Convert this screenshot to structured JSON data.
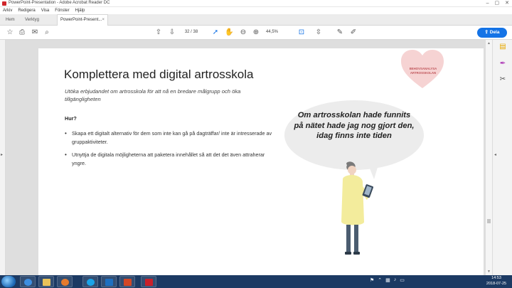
{
  "window": {
    "title": "PowerPoint-Presentation - Adobe Acrobat Reader DC",
    "controls": [
      "–",
      "▢",
      "✕"
    ]
  },
  "menu": [
    "Arkiv",
    "Redigera",
    "Visa",
    "Fönster",
    "Hjälp"
  ],
  "tabs": {
    "home": "Hem",
    "tools": "Verktyg",
    "document": "PowerPoint-Present...",
    "close": "×"
  },
  "toolbar": {
    "page_indicator": "32 / 38",
    "zoom": "44,5%",
    "share_label": "Dela"
  },
  "slide": {
    "title": "Komplettera med digital artrosskola",
    "subtitle": "Utöka erbjudandet om artrosskola för att nå en bredare målgrupp och öka tillgängligheten",
    "how_heading": "Hur?",
    "bullets": [
      "Skapa ett digitalt alternativ för dem som inte kan gå på dagträffar/ inte är intresserade av gruppaktiviteter.",
      "Utnyttja de digitala möjligheterna att paketera innehållet så att det det även attraherar yngre."
    ],
    "heart_label": "BEHOVSANALYSA ARTROSSKOLAN",
    "quote": "Om artrosskolan hade funnits på nätet hade jag nog gjort den, idag finns inte tiden"
  },
  "taskbar": {
    "time": "14:53",
    "date": "2018-07-25"
  },
  "colors": {
    "accent": "#1473e6",
    "heart": "#f6d3d3",
    "bubble": "#ececec",
    "taskbar": "#1c3a63"
  }
}
